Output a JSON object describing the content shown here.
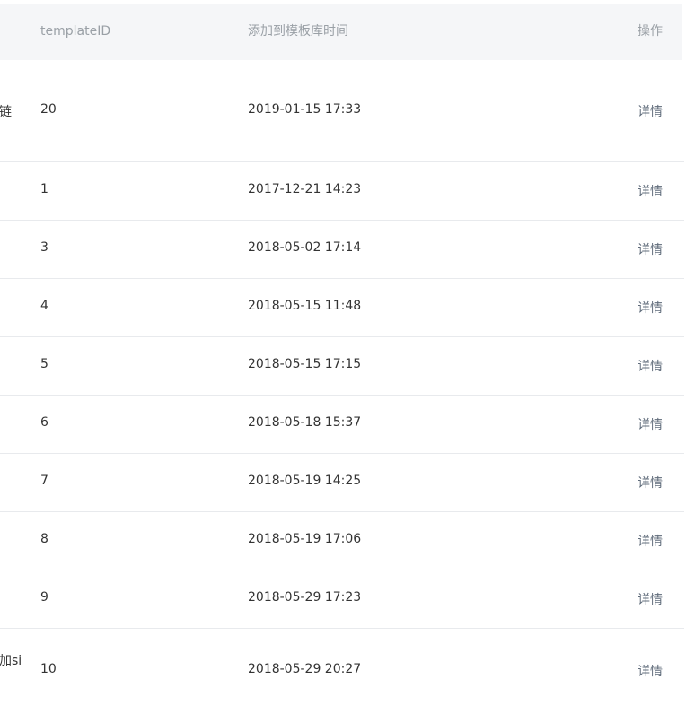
{
  "header": {
    "col_template_id": "templateID",
    "col_added_time": "添加到模板库时间",
    "col_action": "操作"
  },
  "rows": [
    {
      "left_fragment": "链",
      "template_id": "20",
      "added_time": "2019-01-15 17:33",
      "action": "详情"
    },
    {
      "left_fragment": "",
      "template_id": "1",
      "added_time": "2017-12-21 14:23",
      "action": "详情"
    },
    {
      "left_fragment": "",
      "template_id": "3",
      "added_time": "2018-05-02 17:14",
      "action": "详情"
    },
    {
      "left_fragment": "",
      "template_id": "4",
      "added_time": "2018-05-15 11:48",
      "action": "详情"
    },
    {
      "left_fragment": "",
      "template_id": "5",
      "added_time": "2018-05-15 17:15",
      "action": "详情"
    },
    {
      "left_fragment": "",
      "template_id": "6",
      "added_time": "2018-05-18 15:37",
      "action": "详情"
    },
    {
      "left_fragment": "",
      "template_id": "7",
      "added_time": "2018-05-19 14:25",
      "action": "详情"
    },
    {
      "left_fragment": "",
      "template_id": "8",
      "added_time": "2018-05-19 17:06",
      "action": "详情"
    },
    {
      "left_fragment": "",
      "template_id": "9",
      "added_time": "2018-05-29 17:23",
      "action": "详情"
    },
    {
      "left_fragment": "加si",
      "template_id": "10",
      "added_time": "2018-05-29 20:27",
      "action": "详情"
    }
  ]
}
